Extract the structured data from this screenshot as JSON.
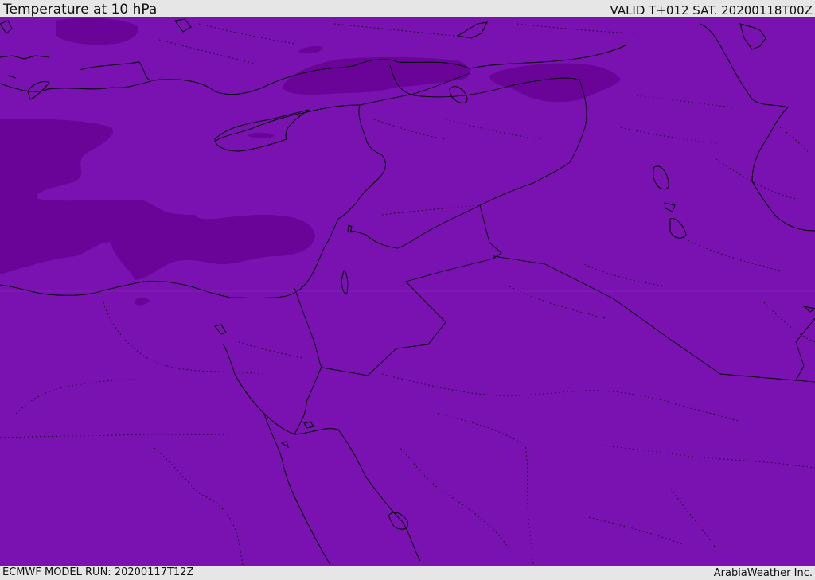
{
  "header": {
    "title": "Temperature at 10 hPa",
    "valid": "VALID T+012 SAT. 20200118T00Z"
  },
  "footer": {
    "model_run": "ECMWF MODEL RUN: 20200117T12Z",
    "credit": "ArabiaWeather Inc."
  },
  "map": {
    "colors": {
      "base_fill": "#7a12b1",
      "cold_fill": "#6a0398",
      "coastline": "#000000",
      "border": "#000000"
    }
  }
}
